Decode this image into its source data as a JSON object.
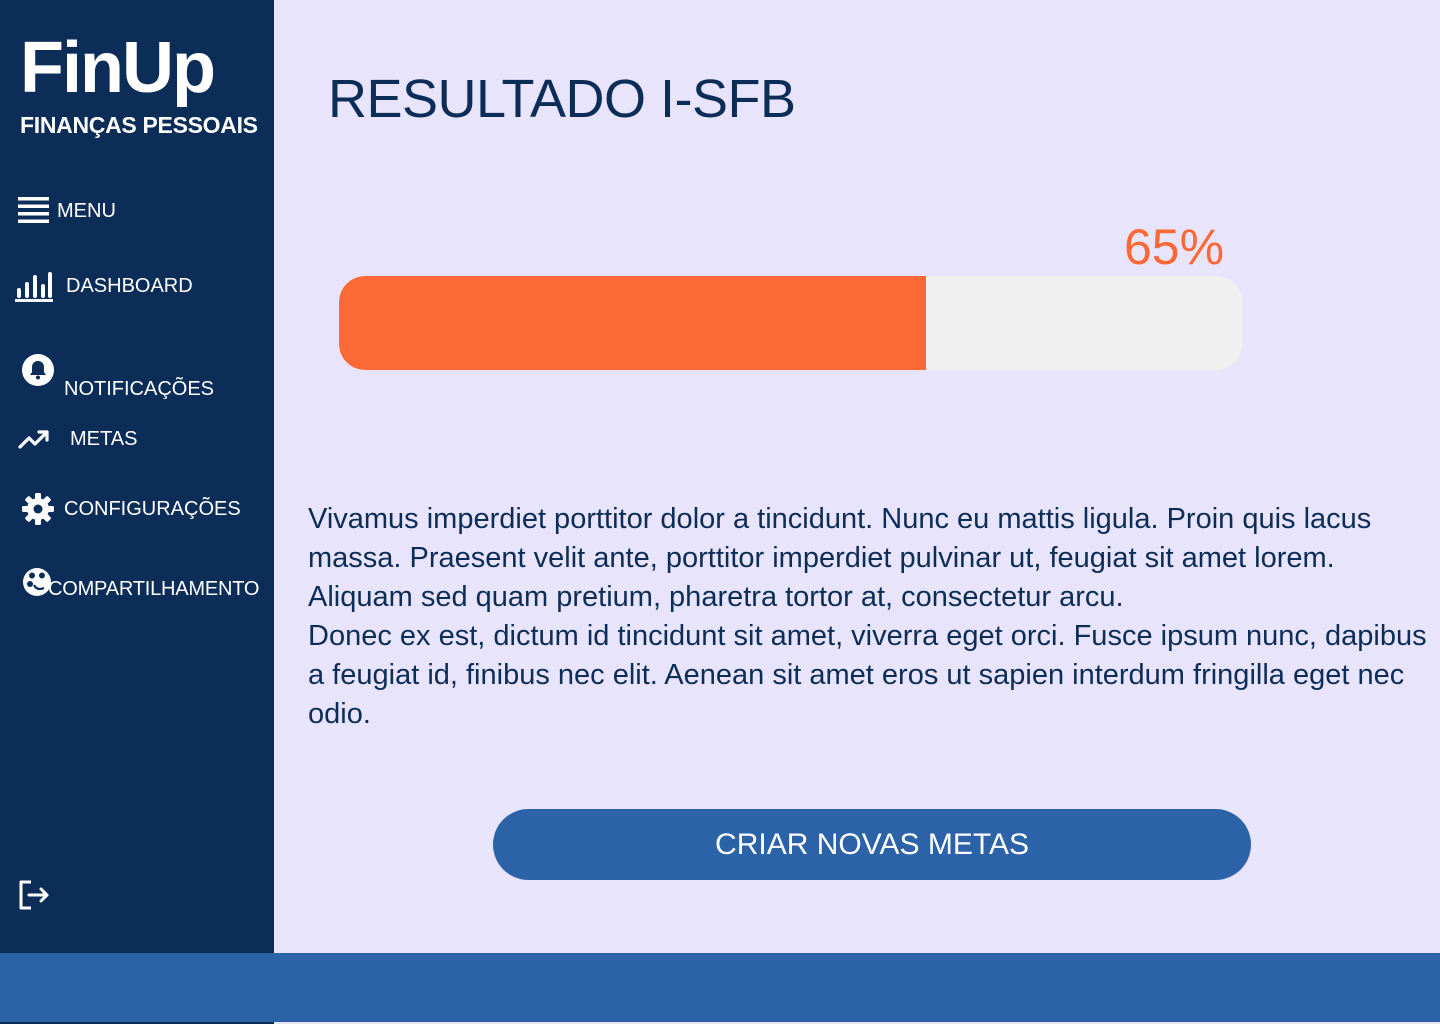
{
  "brand": {
    "name": "FinUp",
    "subtitle": "FINANÇAS PESSOAIS"
  },
  "sidebar": {
    "items": [
      {
        "label": "MENU",
        "icon": "menu-icon"
      },
      {
        "label": "DASHBOARD",
        "icon": "bar-chart-icon"
      },
      {
        "label": "NOTIFICAÇÕES",
        "icon": "bell-icon"
      },
      {
        "label": "METAS",
        "icon": "trending-up-icon"
      },
      {
        "label": "CONFIGURAÇÕES",
        "icon": "gear-icon"
      },
      {
        "label": "COMPARTILHAMENTO",
        "icon": "share-icon"
      }
    ],
    "logout_icon": "logout-icon"
  },
  "main": {
    "title": "RESULTADO I-SFB",
    "progress": {
      "label": "65%",
      "value": 65
    },
    "paragraphs": [
      "Vivamus imperdiet porttitor dolor a tincidunt. Nunc eu mattis ligula. Proin quis lacus massa. Praesent velit ante, porttitor imperdiet pulvinar ut, feugiat sit amet lorem. Aliquam sed quam pretium, pharetra tortor at, consectetur arcu.",
      "Donec ex est, dictum id tincidunt sit amet, viverra eget orci. Fusce ipsum nunc, dapibus a feugiat id, finibus nec elit. Aenean sit amet eros ut sapien interdum fringilla eget nec odio."
    ],
    "cta_label": "CRIAR NOVAS METAS"
  },
  "colors": {
    "sidebar": "#0d2d59",
    "background": "#e8e4fc",
    "accent": "#fb6a36",
    "primary": "#2b62a8",
    "track": "#f0f0f0"
  }
}
